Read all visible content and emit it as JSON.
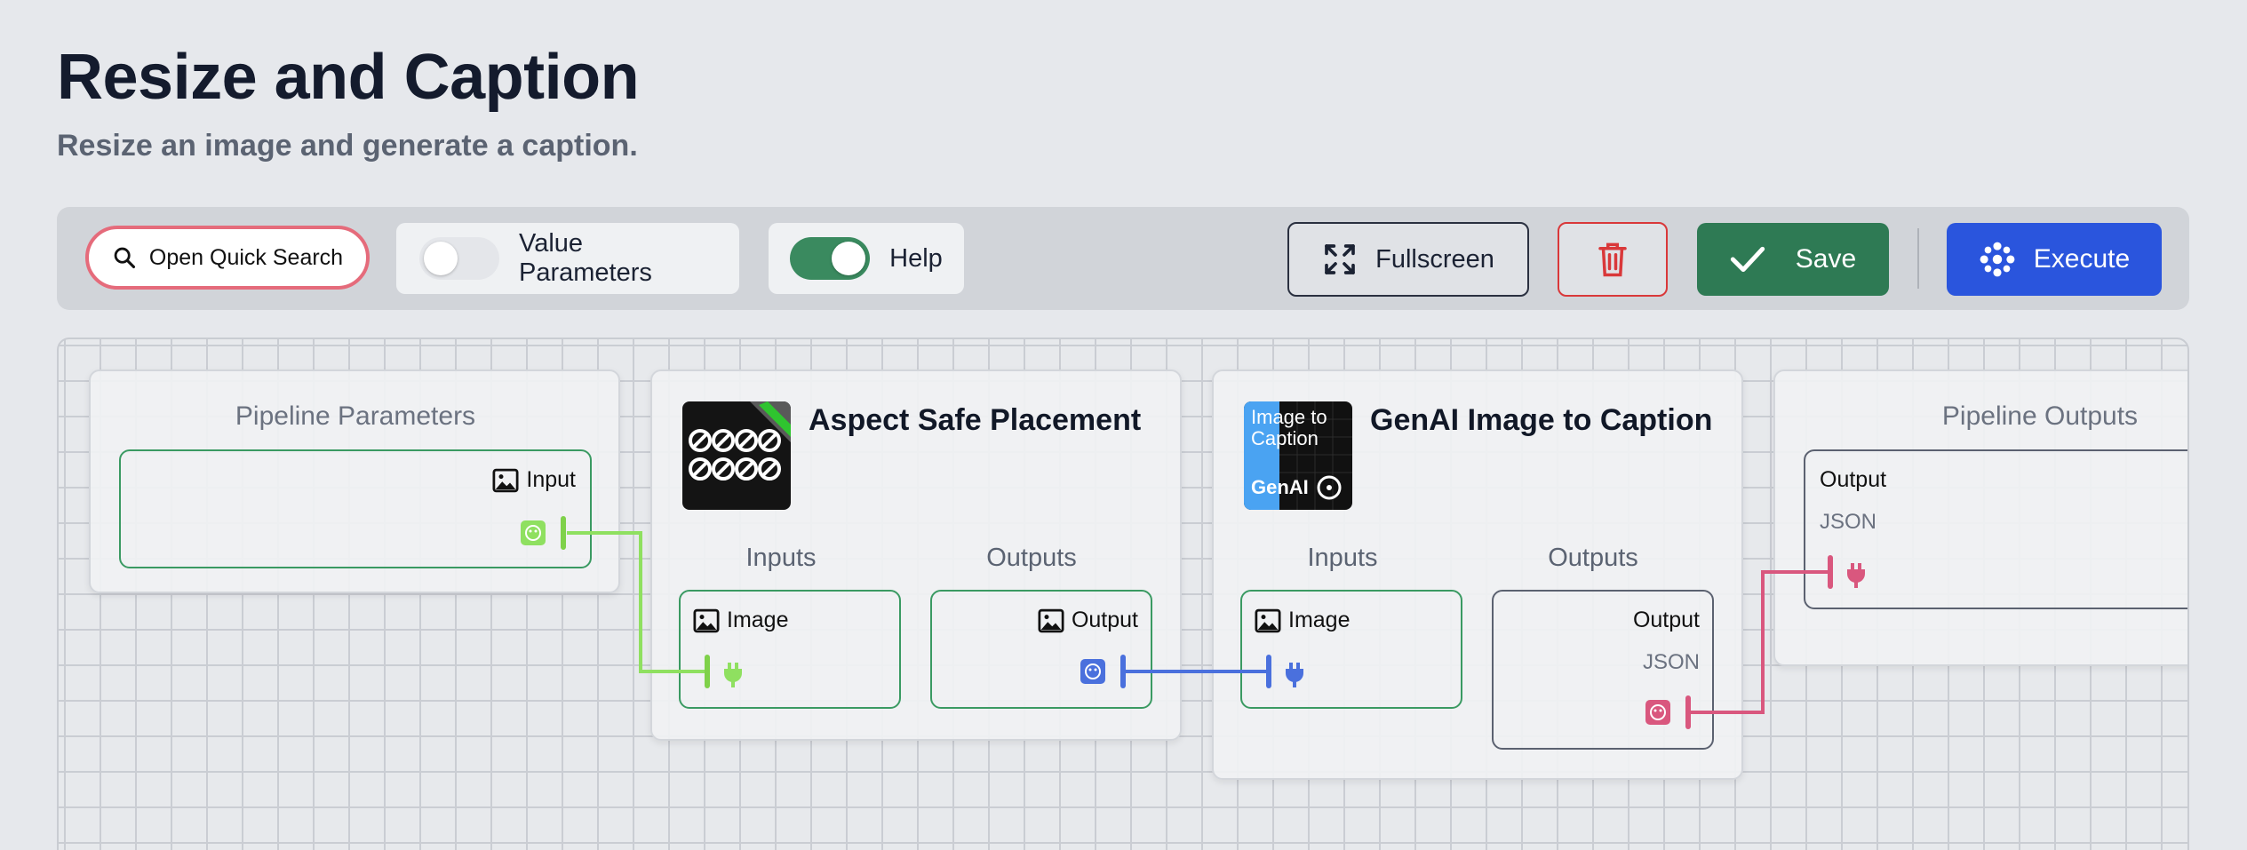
{
  "page": {
    "title": "Resize and Caption",
    "subtitle": "Resize an image and generate a caption."
  },
  "toolbar": {
    "quick_search_label": "Open Quick Search",
    "value_parameters_label": "Value Parameters",
    "value_parameters_on": false,
    "help_label": "Help",
    "help_on": true,
    "fullscreen_label": "Fullscreen",
    "save_label": "Save",
    "execute_label": "Execute"
  },
  "nodes": {
    "pipeline_parameters": {
      "heading": "Pipeline Parameters",
      "port_label": "Input"
    },
    "aspect_safe_placement": {
      "title": "Aspect Safe Placement",
      "inputs_label": "Inputs",
      "outputs_label": "Outputs",
      "input_port": "Image",
      "output_port": "Output"
    },
    "genai_caption": {
      "title": "GenAI Image to Caption",
      "thumb_text": [
        "Image to",
        "Caption"
      ],
      "thumb_brand": "GenAI",
      "inputs_label": "Inputs",
      "outputs_label": "Outputs",
      "input_port": "Image",
      "output_port": "Output",
      "output_type": "JSON"
    },
    "pipeline_outputs": {
      "heading": "Pipeline Outputs",
      "port_label": "Output",
      "port_type": "JSON"
    }
  },
  "colors": {
    "image_wire": "#8fe060",
    "image_wire_dark": "#7fd14a",
    "blue_wire": "#4a70dd",
    "json_wire": "#d9577e",
    "save": "#2e7a54",
    "execute": "#2a55dd",
    "delete": "#d9383a"
  }
}
